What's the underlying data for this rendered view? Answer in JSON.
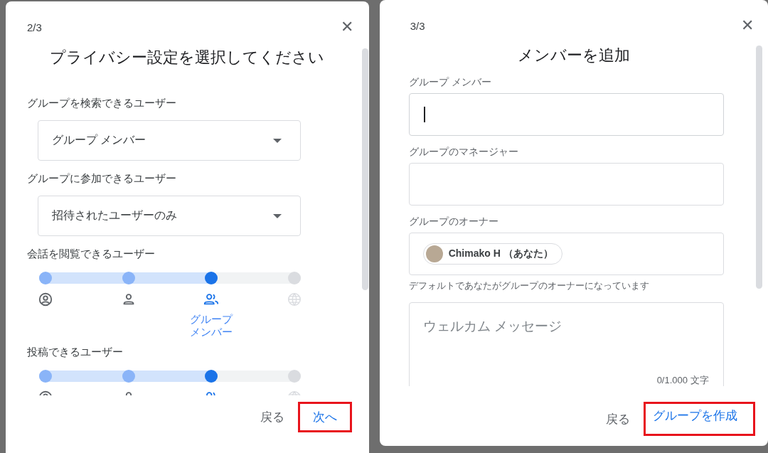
{
  "privacy_dialog": {
    "step": "2/3",
    "close": "✕",
    "title": "プライバシー設定を選択してください",
    "selects": [
      {
        "label": "グループを検索できるユーザー",
        "value": "グループ メンバー"
      },
      {
        "label": "グループに参加できるユーザー",
        "value": "招待されたユーザーのみ"
      }
    ],
    "sliders": [
      {
        "label": "会話を閲覧できるユーザー",
        "level": 0.6667,
        "selected_label": "グループメンバー"
      },
      {
        "label": "投稿できるユーザー",
        "level": 0.6667
      }
    ],
    "buttons": [
      {
        "label": "戻る",
        "primary": false,
        "highlighted": false
      },
      {
        "label": "次へ",
        "primary": true,
        "highlighted": true
      }
    ]
  },
  "members_dialog": {
    "step": "3/3",
    "close": "✕",
    "title": "メンバーを追加",
    "fields": [
      {
        "label": "グループ メンバー",
        "focused": true
      },
      {
        "label": "グループのマネージャー",
        "focused": false
      }
    ],
    "owner": {
      "label": "グループのオーナー",
      "chip": "Chimako H （あなた）",
      "helper": "デフォルトであなたがグループのオーナーになっています"
    },
    "welcome": {
      "placeholder": "ウェルカム メッセージ",
      "counter": "0/1.000 文字"
    },
    "buttons": [
      {
        "label": "戻る",
        "primary": false,
        "highlighted": false
      },
      {
        "label": "グループを作成",
        "primary": true,
        "highlighted": true
      }
    ]
  }
}
